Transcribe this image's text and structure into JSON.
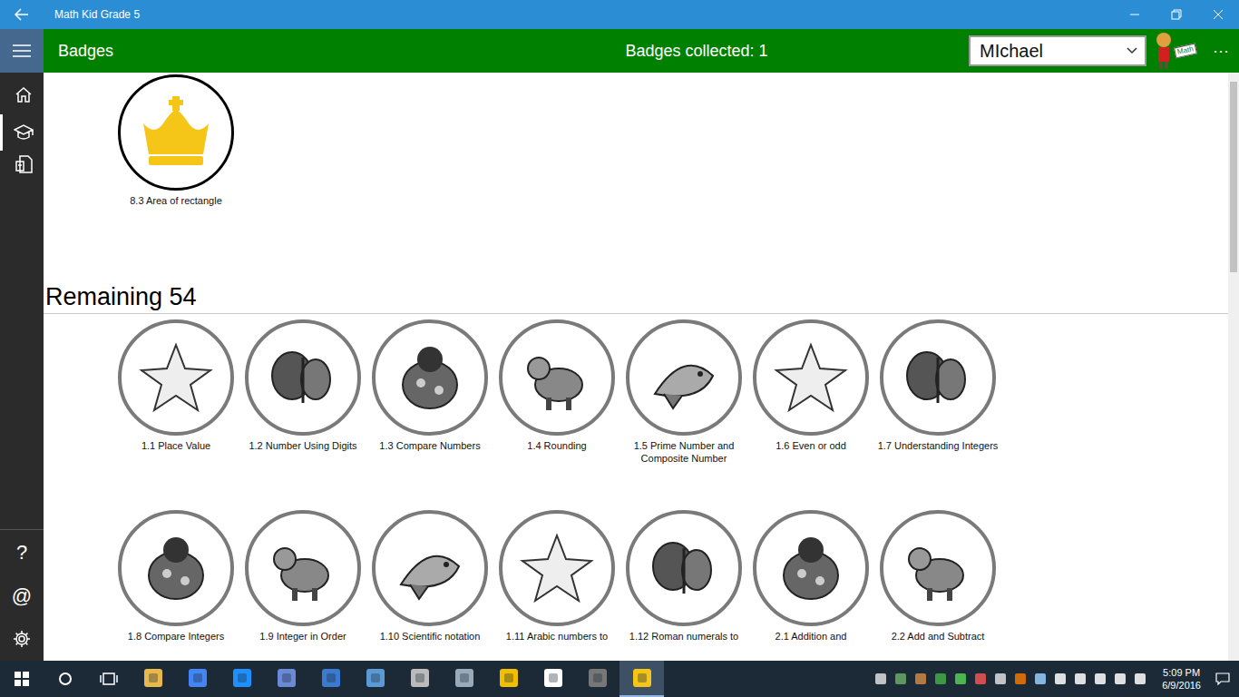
{
  "window": {
    "title": "Math Kid Grade 5"
  },
  "header": {
    "title": "Badges",
    "collected_count": "Badges collected: 1",
    "user": "MIchael",
    "mascot_sign": "Math",
    "more": "···"
  },
  "nav": {
    "top_items": [
      {
        "selected": false
      },
      {
        "selected": true
      },
      {
        "selected": false
      }
    ],
    "bottom_items": [
      {
        "glyph": "?"
      },
      {
        "glyph": "@"
      }
    ]
  },
  "collected": [
    {
      "label": "8.3 Area of rectangle"
    }
  ],
  "remaining": {
    "heading": "Remaining 54",
    "badges": [
      {
        "label": "1.1 Place Value"
      },
      {
        "label": "1.2 Number Using Digits"
      },
      {
        "label": "1.3 Compare Numbers"
      },
      {
        "label": "1.4 Rounding"
      },
      {
        "label": "1.5 Prime Number and Composite Number"
      },
      {
        "label": "1.6 Even or odd"
      },
      {
        "label": "1.7 Understanding Integers"
      },
      {
        "label": "1.8 Compare Integers"
      },
      {
        "label": "1.9 Integer in Order"
      },
      {
        "label": "1.10 Scientific notation"
      },
      {
        "label": "1.11 Arabic numbers to"
      },
      {
        "label": "1.12 Roman numerals to"
      },
      {
        "label": "2.1 Addition and"
      },
      {
        "label": "2.2 Add and Subtract"
      }
    ]
  },
  "taskbar": {
    "apps": [
      {
        "selected": false
      },
      {
        "selected": false
      },
      {
        "selected": false
      },
      {
        "selected": false
      },
      {
        "selected": false
      },
      {
        "selected": false
      },
      {
        "selected": false
      },
      {
        "selected": false
      },
      {
        "selected": false
      },
      {
        "selected": false
      },
      {
        "selected": false
      },
      {
        "selected": true
      }
    ],
    "time": "5:09 PM",
    "date": "6/9/2016"
  }
}
